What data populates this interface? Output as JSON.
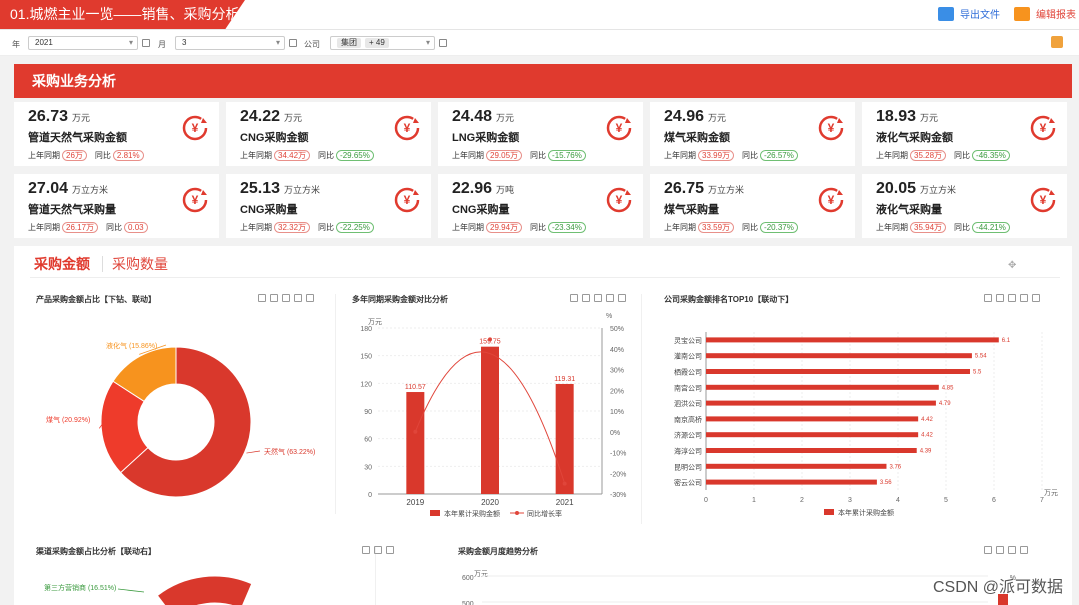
{
  "header": {
    "title": "01.城燃主业一览——销售、采购分析",
    "export_label": "导出文件",
    "edit_label": "编辑报表"
  },
  "filters": {
    "year_label": "年",
    "year_value": "2021",
    "month_label": "月",
    "month_value": "3",
    "company_label": "公司",
    "company_chip": "集团",
    "company_more": "+ 49"
  },
  "section_title": "采购业务分析",
  "kpis": [
    {
      "value": "26.73",
      "unit": "万元",
      "name": "管道天然气采购金额",
      "prev_label": "上年同期",
      "prev": "26万",
      "yoy_label": "同比",
      "yoy": "2.81%",
      "yoy_dir": "up"
    },
    {
      "value": "24.22",
      "unit": "万元",
      "name": "CNG采购金额",
      "prev_label": "上年同期",
      "prev": "34.42万",
      "yoy_label": "同比",
      "yoy": "-29.65%",
      "yoy_dir": "down"
    },
    {
      "value": "24.48",
      "unit": "万元",
      "name": "LNG采购金额",
      "prev_label": "上年同期",
      "prev": "29.05万",
      "yoy_label": "同比",
      "yoy": "-15.76%",
      "yoy_dir": "down"
    },
    {
      "value": "24.96",
      "unit": "万元",
      "name": "煤气采购金额",
      "prev_label": "上年同期",
      "prev": "33.99万",
      "yoy_label": "同比",
      "yoy": "-26.57%",
      "yoy_dir": "down"
    },
    {
      "value": "18.93",
      "unit": "万元",
      "name": "液化气采购金额",
      "prev_label": "上年同期",
      "prev": "35.28万",
      "yoy_label": "同比",
      "yoy": "-46.35%",
      "yoy_dir": "down"
    },
    {
      "value": "27.04",
      "unit": "万立方米",
      "name": "管道天然气采购量",
      "prev_label": "上年同期",
      "prev": "26.17万",
      "yoy_label": "同比",
      "yoy": "0.03",
      "yoy_dir": "up"
    },
    {
      "value": "25.13",
      "unit": "万立方米",
      "name": "CNG采购量",
      "prev_label": "上年同期",
      "prev": "32.32万",
      "yoy_label": "同比",
      "yoy": "-22.25%",
      "yoy_dir": "down"
    },
    {
      "value": "22.96",
      "unit": "万吨",
      "name": "CNG采购量",
      "prev_label": "上年同期",
      "prev": "29.94万",
      "yoy_label": "同比",
      "yoy": "-23.34%",
      "yoy_dir": "down"
    },
    {
      "value": "26.75",
      "unit": "万立方米",
      "name": "煤气采购量",
      "prev_label": "上年同期",
      "prev": "33.59万",
      "yoy_label": "同比",
      "yoy": "-20.37%",
      "yoy_dir": "down"
    },
    {
      "value": "20.05",
      "unit": "万立方米",
      "name": "液化气采购量",
      "prev_label": "上年同期",
      "prev": "35.94万",
      "yoy_label": "同比",
      "yoy": "-44.21%",
      "yoy_dir": "down"
    }
  ],
  "tabs": [
    "采购金额",
    "采购数量"
  ],
  "watermark": "CSDN @派可数据",
  "colors": {
    "accent": "#e03a2e",
    "orange": "#f7931e",
    "green": "#3a9a3e"
  },
  "chart_data": [
    {
      "type": "pie",
      "title": "产品采购金额占比【下钻、联动】",
      "labels": [
        "天然气",
        "煤气",
        "液化气"
      ],
      "values": [
        63.22,
        20.92,
        15.86
      ],
      "label_text": [
        "天然气 (63.22%)",
        "煤气 (20.92%)",
        "液化气 (15.86%)"
      ],
      "colors": [
        "#d9382c",
        "#ee3b2b",
        "#f7931e"
      ]
    },
    {
      "type": "bar",
      "title": "多年同期采购金额对比分析",
      "categories": [
        "2019",
        "2020",
        "2021"
      ],
      "series": [
        {
          "name": "本年累计采购金额",
          "values": [
            110.57,
            159.75,
            119.31
          ]
        },
        {
          "name": "同比增长率",
          "values": [
            0,
            44.5,
            -25
          ]
        }
      ],
      "y_unit": "万元",
      "y2_unit": "%",
      "ylim": [
        0,
        180
      ],
      "yticks": [
        0,
        30,
        60,
        90,
        120,
        150,
        180
      ],
      "y2lim": [
        -30,
        50
      ],
      "y2ticks": [
        "50%",
        "40%",
        "30%",
        "20%",
        "10%",
        "0%",
        "-10%",
        "-20%",
        "-30%"
      ],
      "data_labels": [
        "110.57",
        "159.75",
        "119.31"
      ]
    },
    {
      "type": "bar",
      "title": "公司采购金额排名TOP10【联动下】",
      "categories": [
        "灵宝公司",
        "灌南公司",
        "栖霞公司",
        "南宫公司",
        "泗洪公司",
        "南京高桥",
        "济源公司",
        "海淳公司",
        "昆明公司",
        "密云公司"
      ],
      "series": [
        {
          "name": "本年累计采购金额",
          "values": [
            6.1,
            5.54,
            5.5,
            4.85,
            4.79,
            4.42,
            4.42,
            4.39,
            3.76,
            3.56
          ]
        }
      ],
      "xlim": [
        0,
        7
      ],
      "xticks": [
        0,
        1,
        2,
        3,
        4,
        5,
        6,
        7
      ],
      "x_unit": "万元"
    },
    {
      "type": "pie",
      "title": "渠道采购金额占比分析【联动右】",
      "label_text": [
        "第三方营销商 (16.51%)"
      ]
    },
    {
      "type": "line",
      "title": "采购金额月度趋势分析",
      "y_unit": "万元",
      "y2_unit": "%",
      "yticks": [
        600,
        500
      ]
    }
  ]
}
